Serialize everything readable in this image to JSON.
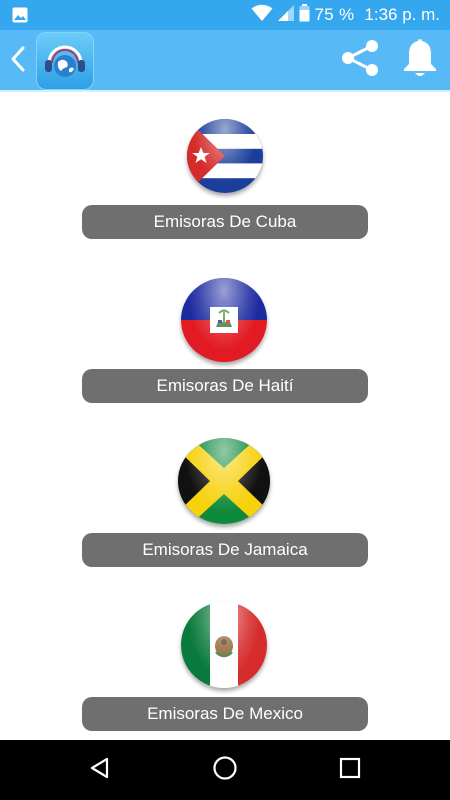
{
  "status_bar": {
    "battery_level": "75 %",
    "time": "1:36 p. m.",
    "background": "#35a7ef"
  },
  "app_bar": {
    "background": "#57b9f5",
    "icons": [
      "back-chevron-icon",
      "app-logo-globe-headphones-icon",
      "share-icon",
      "bell-icon"
    ]
  },
  "stations": [
    {
      "label": "Emisoras De Cuba",
      "flag_icon": "cuba-flag-icon"
    },
    {
      "label": "Emisoras De Haití",
      "flag_icon": "haiti-flag-icon"
    },
    {
      "label": "Emisoras De Jamaica",
      "flag_icon": "jamaica-flag-icon"
    },
    {
      "label": "Emisoras De Mexico",
      "flag_icon": "mexico-flag-icon"
    }
  ],
  "theme": {
    "button_color": "#6f6f6f",
    "button_text_color": "#ffffff"
  },
  "nav_bar": {
    "icons": [
      "back-triangle-icon",
      "home-circle-icon",
      "recents-square-icon"
    ]
  }
}
